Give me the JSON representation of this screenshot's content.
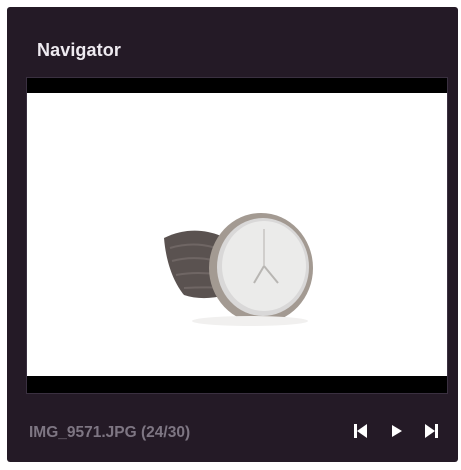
{
  "panel": {
    "title": "Navigator"
  },
  "preview": {
    "image_subject": "wristwatch-photo"
  },
  "status": {
    "filename_text": "IMG_9571.JPG (24/30)"
  },
  "controls": {
    "first_icon": "skip-to-first-icon",
    "play_icon": "play-icon",
    "last_icon": "skip-to-last-icon"
  },
  "colors": {
    "panel_background": "#241a26",
    "title_text": "#eeeaf0",
    "filename_text": "#7e7683",
    "control_icons": "#ffffff",
    "letterbox": "#000000"
  }
}
